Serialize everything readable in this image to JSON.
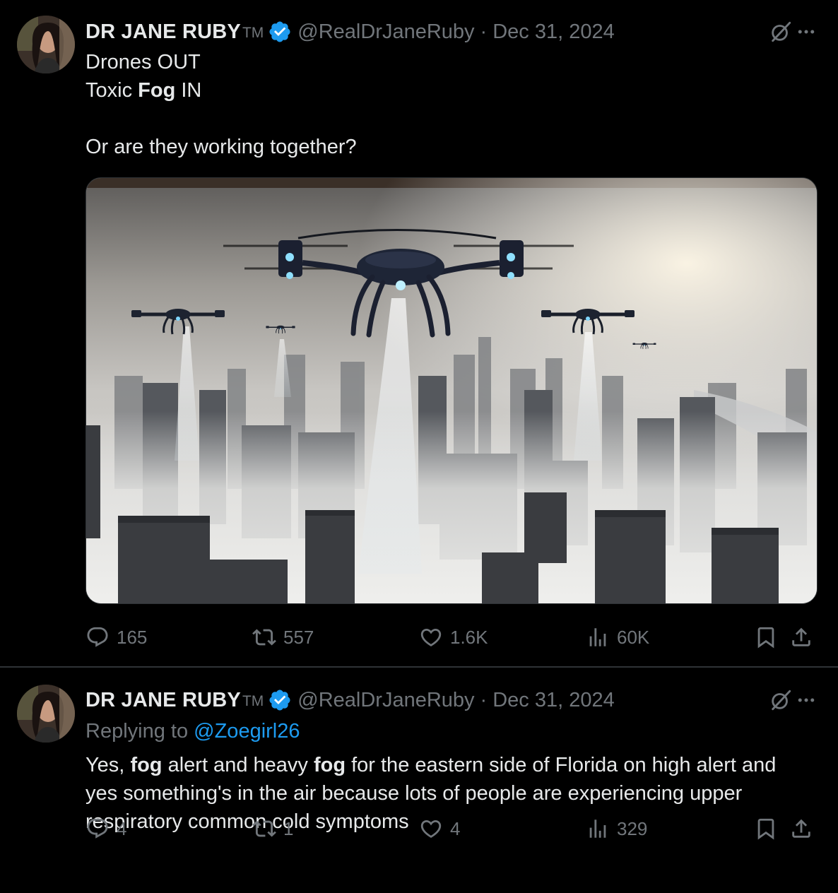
{
  "tweets": [
    {
      "author": {
        "name": "DR JANE RUBY",
        "tm": "TM",
        "handle": "@RealDrJaneRuby",
        "date": "Dec 31, 2024"
      },
      "text": {
        "line1": "Drones OUT",
        "line2_pre": "Toxic ",
        "line2_bold": "Fog",
        "line2_post": " IN",
        "line3": "Or are they working together?"
      },
      "stats": {
        "replies": "165",
        "retweets": "557",
        "likes": "1.6K",
        "views": "60K"
      }
    },
    {
      "author": {
        "name": "DR JANE RUBY",
        "tm": "TM",
        "handle": "@RealDrJaneRuby",
        "date": "Dec 31, 2024"
      },
      "replying_label": "Replying to ",
      "replying_to": "@Zoegirl26",
      "body": {
        "p1": "Yes, ",
        "b1": "fog",
        "p2": " alert and heavy ",
        "b2": "fog",
        "p3": " for the eastern side of Florida on high alert and yes something's in the air because lots of people are experiencing upper respiratory common cold symptoms"
      },
      "stats": {
        "replies": "4",
        "retweets": "1",
        "likes": "4",
        "views": "329"
      }
    }
  ],
  "separator": "·",
  "colors": {
    "background": "#000000",
    "text": "#e7e9ea",
    "muted": "#71767b",
    "accent": "#1d9bf0",
    "divider": "#2f3336"
  },
  "icons": [
    "grok-icon",
    "more-icon",
    "verified-badge-icon",
    "reply-icon",
    "retweet-icon",
    "like-icon",
    "views-icon",
    "bookmark-icon",
    "share-icon"
  ]
}
